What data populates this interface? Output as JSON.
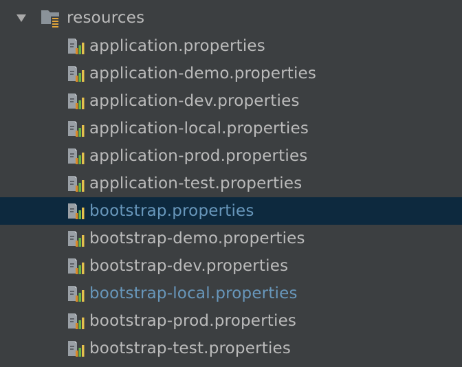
{
  "folder": {
    "name": "resources",
    "expanded": true
  },
  "colors": {
    "background": "#3c3f41",
    "text": "#bbbbbb",
    "selection": "#0d293e",
    "modified_text": "#6897bb",
    "icon_bar_orange": "#d98b28",
    "icon_bar_green": "#62b543",
    "icon_bar_yellow": "#e3c04d"
  },
  "files": [
    {
      "name": "application.properties",
      "state": "normal"
    },
    {
      "name": "application-demo.properties",
      "state": "normal"
    },
    {
      "name": "application-dev.properties",
      "state": "normal"
    },
    {
      "name": "application-local.properties",
      "state": "normal"
    },
    {
      "name": "application-prod.properties",
      "state": "normal"
    },
    {
      "name": "application-test.properties",
      "state": "normal"
    },
    {
      "name": "bootstrap.properties",
      "state": "selected"
    },
    {
      "name": "bootstrap-demo.properties",
      "state": "normal"
    },
    {
      "name": "bootstrap-dev.properties",
      "state": "normal"
    },
    {
      "name": "bootstrap-local.properties",
      "state": "modified"
    },
    {
      "name": "bootstrap-prod.properties",
      "state": "normal"
    },
    {
      "name": "bootstrap-test.properties",
      "state": "normal"
    }
  ],
  "icons": {
    "expand": "triangle-down-icon",
    "folder": "resources-folder-icon",
    "file": "properties-file-icon"
  }
}
